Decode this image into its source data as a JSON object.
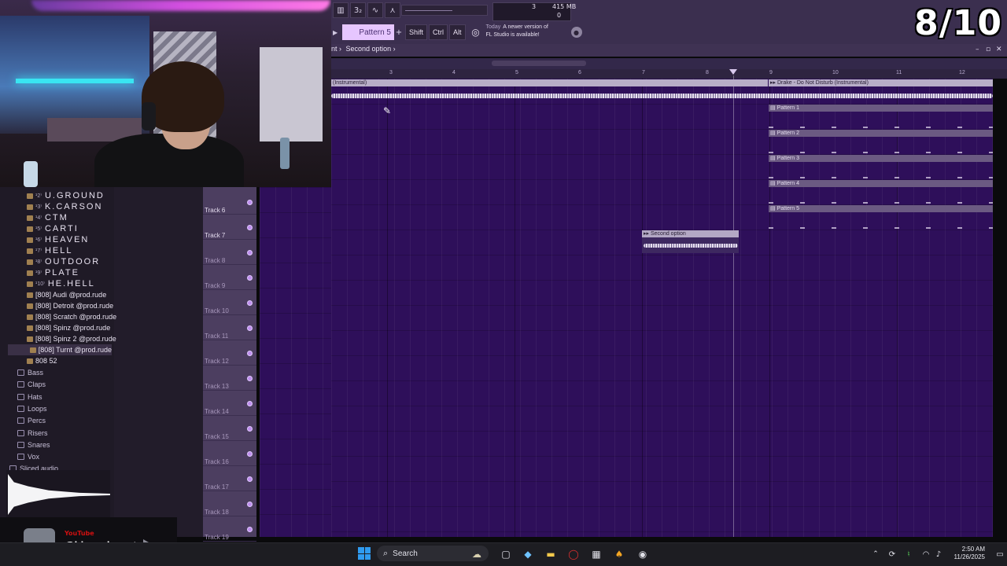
{
  "overlay": {
    "counter": "8/10",
    "youtube_label": "YouTube",
    "youtube_handle": "@bigsackwontsags"
  },
  "toolbar": {
    "memory": "415 MB",
    "cpu_value": "3",
    "poly_value": "0",
    "pattern_selector": "Pattern 5",
    "mod_keys": [
      "Shift",
      "Ctrl",
      "Alt"
    ],
    "news_today": "Today",
    "news_text_line1": "A newer version of",
    "news_text_line2": "FL Studio is available!"
  },
  "playlist": {
    "title_prefix": "nt ›",
    "title": "Second option ›",
    "ruler_ticks": [
      "3",
      "4",
      "5",
      "6",
      "7",
      "8",
      "9",
      "10",
      "11",
      "12"
    ],
    "audio_clip_left": "(Instrumental)",
    "audio_clip_right": "Drake - Do Not Disturb (Instrumental)",
    "audio_clip_second": "Second option",
    "patterns": [
      "Pattern 1",
      "Pattern 2",
      "Pattern 3",
      "Pattern 4",
      "Pattern 5"
    ],
    "tracks": [
      {
        "name": "Track 6",
        "dim": false
      },
      {
        "name": "Track 7",
        "dim": false
      },
      {
        "name": "Track 8",
        "dim": true
      },
      {
        "name": "Track 9",
        "dim": true
      },
      {
        "name": "Track 10",
        "dim": true
      },
      {
        "name": "Track 11",
        "dim": true
      },
      {
        "name": "Track 12",
        "dim": true
      },
      {
        "name": "Track 13",
        "dim": true
      },
      {
        "name": "Track 14",
        "dim": true
      },
      {
        "name": "Track 15",
        "dim": true
      },
      {
        "name": "Track 16",
        "dim": true
      },
      {
        "name": "Track 17",
        "dim": true
      },
      {
        "name": "Track 18",
        "dim": true
      },
      {
        "name": "Track 19",
        "dim": true
      }
    ]
  },
  "browser": {
    "presets": [
      {
        "num": "¹2⁾",
        "label": "U.GROUND"
      },
      {
        "num": "¹3⁾",
        "label": "K.CARSON"
      },
      {
        "num": "¹4⁾",
        "label": "CTM"
      },
      {
        "num": "¹5⁾",
        "label": "CARTI"
      },
      {
        "num": "¹6⁾",
        "label": "HEAVEN"
      },
      {
        "num": "¹7⁾",
        "label": "HELL"
      },
      {
        "num": "¹8⁾",
        "label": "OUTDOOR"
      },
      {
        "num": "¹9⁾",
        "label": "PLATE"
      },
      {
        "num": "¹10⁾",
        "label": "HE.HELL"
      }
    ],
    "samples": [
      "[808] Audi @prod.rude",
      "[808] Detroit @prod.rude",
      "[808] Scratch @prod.rude",
      "[808] Spinz @prod.rude",
      "[808] Spinz 2 @prod.rude",
      "[808] Turnt @prod.rude",
      "808 52"
    ],
    "folders": [
      "Bass",
      "Claps",
      "Hats",
      "Loops",
      "Percs",
      "Risers",
      "Snares",
      "Vox",
      "Sliced audio"
    ]
  },
  "taskbar": {
    "search_placeholder": "Search",
    "time": "2:50 AM",
    "date": "11/26/2025"
  },
  "colors": {
    "grid_bg": "#2e0f5a",
    "pattern_selector": "#e6c6ff",
    "track_header": "#4c3e60"
  }
}
